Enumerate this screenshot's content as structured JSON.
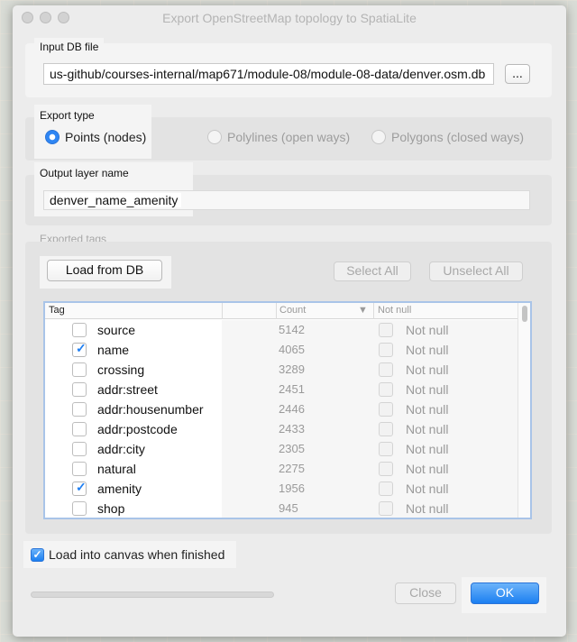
{
  "window": {
    "title": "Export OpenStreetMap topology to SpatiaLite"
  },
  "input_db": {
    "label": "Input DB file",
    "value": "us-github/courses-internal/map671/module-08/module-08-data/denver.osm.db",
    "browse_label": "..."
  },
  "export_type": {
    "label": "Export type",
    "options": [
      {
        "label": "Points (nodes)",
        "selected": true,
        "enabled": true
      },
      {
        "label": "Polylines (open ways)",
        "selected": false,
        "enabled": false
      },
      {
        "label": "Polygons (closed ways)",
        "selected": false,
        "enabled": false
      }
    ]
  },
  "output_layer": {
    "label": "Output layer name",
    "value": "denver_name_amenity"
  },
  "exported_tags": {
    "label": "Exported tags",
    "load_button": "Load from DB",
    "select_all": "Select All",
    "unselect_all": "Unselect All",
    "columns": {
      "tag": "Tag",
      "count": "Count",
      "not_null": "Not null",
      "sort_indicator": "▼"
    },
    "rows": [
      {
        "tag": "source",
        "count": "5142",
        "checked": false,
        "not_null": "Not null"
      },
      {
        "tag": "name",
        "count": "4065",
        "checked": true,
        "not_null": "Not null"
      },
      {
        "tag": "crossing",
        "count": "3289",
        "checked": false,
        "not_null": "Not null"
      },
      {
        "tag": "addr:street",
        "count": "2451",
        "checked": false,
        "not_null": "Not null"
      },
      {
        "tag": "addr:housenumber",
        "count": "2446",
        "checked": false,
        "not_null": "Not null"
      },
      {
        "tag": "addr:postcode",
        "count": "2433",
        "checked": false,
        "not_null": "Not null"
      },
      {
        "tag": "addr:city",
        "count": "2305",
        "checked": false,
        "not_null": "Not null"
      },
      {
        "tag": "natural",
        "count": "2275",
        "checked": false,
        "not_null": "Not null"
      },
      {
        "tag": "amenity",
        "count": "1956",
        "checked": true,
        "not_null": "Not null"
      },
      {
        "tag": "shop",
        "count": "945",
        "checked": false,
        "not_null": "Not null"
      }
    ]
  },
  "load_into_canvas": {
    "label": "Load into canvas when finished",
    "checked": true
  },
  "progress": {
    "value": 0
  },
  "buttons": {
    "close": "Close",
    "ok": "OK"
  },
  "colors": {
    "accent": "#1b7ff1",
    "check": "#1f7ff2",
    "dialog_bg": "#ececec"
  }
}
